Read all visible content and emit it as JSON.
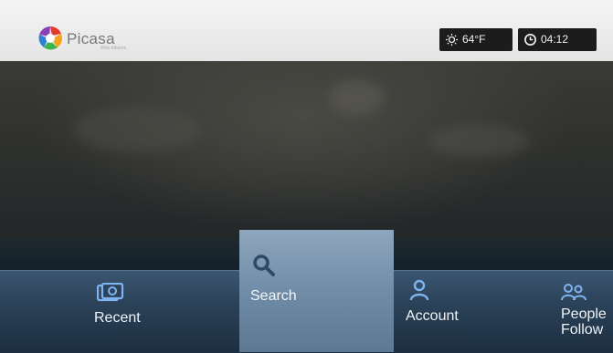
{
  "app": {
    "title": "Picasa",
    "subtitle": "Web Albums"
  },
  "status": {
    "temperature": "64°F",
    "time": "04:12",
    "weather_icon": "weather-icon",
    "clock_icon": "clock-icon"
  },
  "menu": {
    "items": [
      {
        "label": "Recent",
        "icon": "photos-icon"
      },
      {
        "label": "Search",
        "icon": "search-icon",
        "selected": true
      },
      {
        "label": "Account",
        "icon": "person-icon"
      },
      {
        "label": "People\nFollow",
        "icon": "people-icon"
      }
    ]
  },
  "colors": {
    "header": "#ececec",
    "menu_bar": "#2b4258",
    "menu_selected": "#7a94ad",
    "icon_accent": "#7db4f0"
  }
}
